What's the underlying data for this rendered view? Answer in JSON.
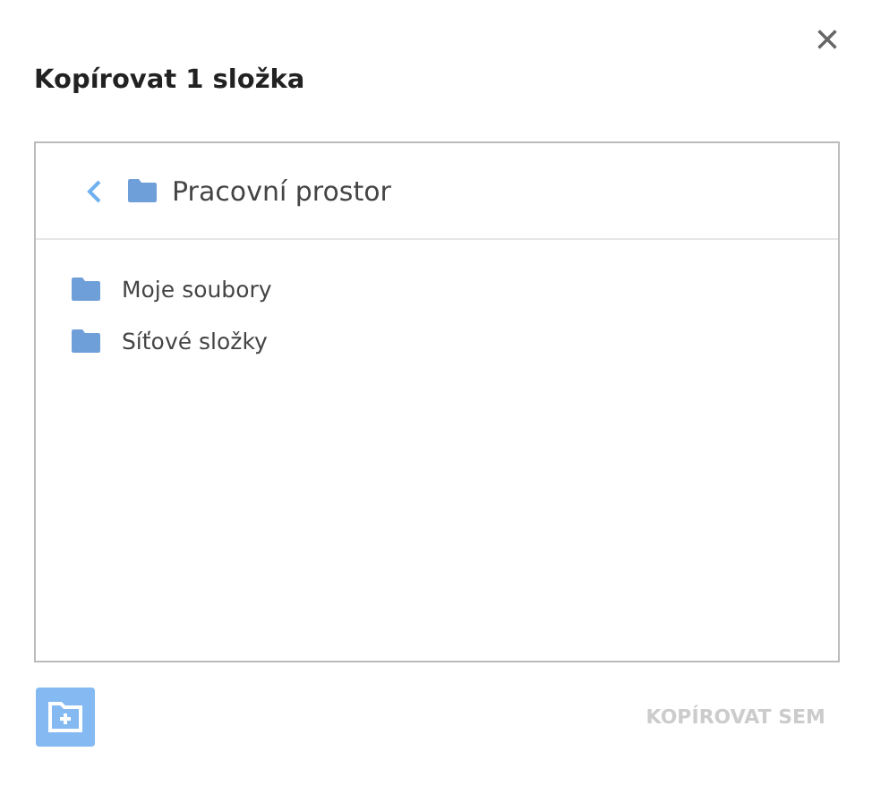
{
  "dialog": {
    "title": "Kopírovat 1 složka",
    "close": "×"
  },
  "browser": {
    "path": "Pracovní prostor",
    "items": [
      {
        "label": "Moje soubory"
      },
      {
        "label": "Síťové složky"
      }
    ]
  },
  "footer": {
    "copy_button": {
      "label": "KOPÍROVAT SEM",
      "disabled": true
    }
  }
}
